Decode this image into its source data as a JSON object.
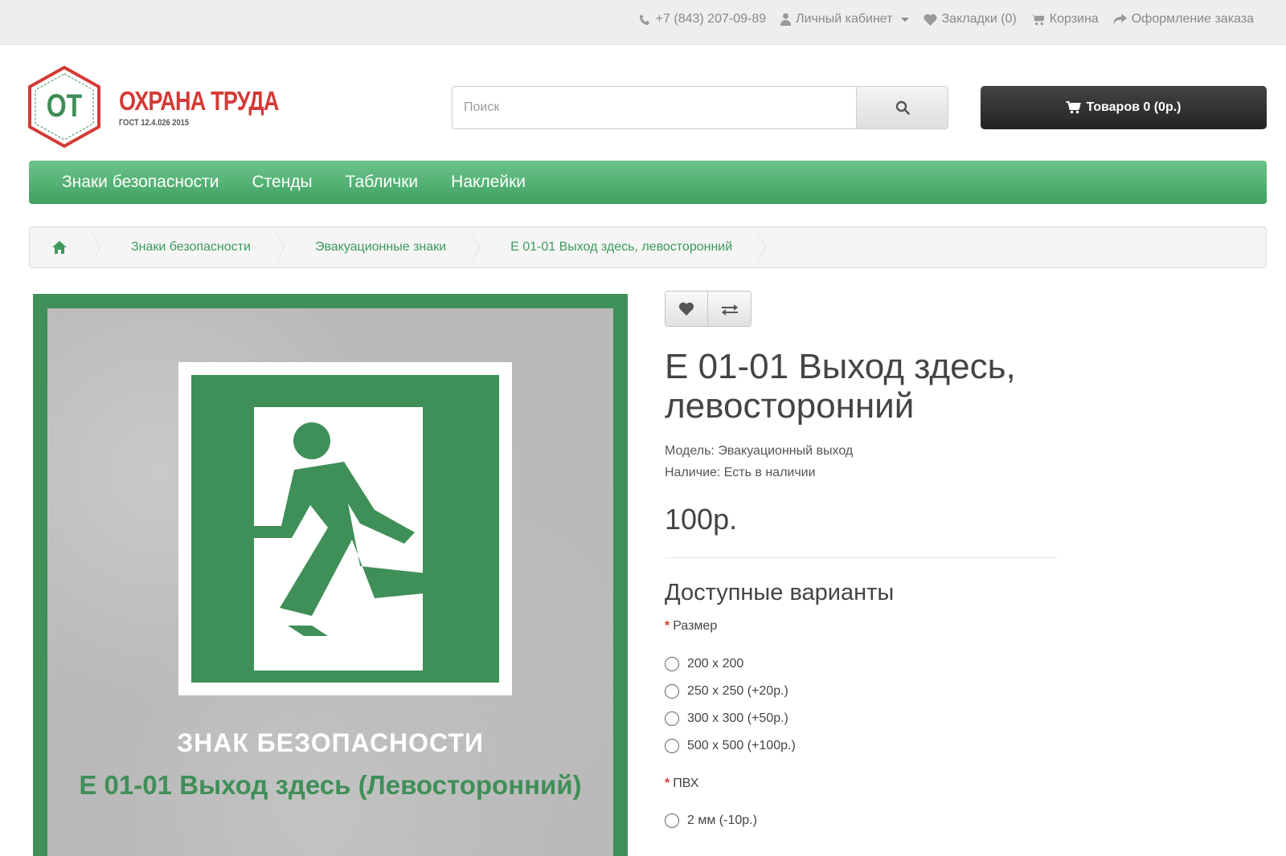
{
  "topbar": {
    "phone": "+7 (843) 207-09-89",
    "account": "Личный кабинет",
    "wishlist": "Закладки (0)",
    "cart": "Корзина",
    "checkout": "Оформление заказа"
  },
  "logo": {
    "mark": "ОТ",
    "name": "ОХРАНА ТРУДА",
    "subtitle": "ГОСТ 12.4.026 2015"
  },
  "search": {
    "placeholder": "Поиск"
  },
  "cart_button": {
    "label": "Товаров 0 (0р.)"
  },
  "menu": {
    "items": [
      "Знаки безопасности",
      "Стенды",
      "Таблички",
      "Наклейки"
    ]
  },
  "breadcrumb": {
    "items": [
      "Знаки безопасности",
      "Эвакуационные знаки",
      "Е 01-01 Выход здесь, левосторонний"
    ]
  },
  "product_image": {
    "caption1": "ЗНАК БЕЗОПАСНОСТИ",
    "caption2": "Е 01-01 Выход здесь (Левосторонний)"
  },
  "product": {
    "title": "Е 01-01 Выход здесь, левосторонний",
    "model": "Модель: Эвакуационный выход",
    "availability": "Наличие: Есть в наличии",
    "price": "100р."
  },
  "options": {
    "title": "Доступные варианты",
    "size_label": "Размер",
    "sizes": [
      "200 х 200",
      "250 х 250 (+20р.)",
      "300 х 300 (+50р.)",
      "500 х 500 (+100р.)"
    ],
    "pvc_label": "ПВХ",
    "pvc": [
      "2 мм (-10р.)"
    ]
  },
  "colors": {
    "brand_green": "#3f8f58",
    "brand_red": "#d33b36",
    "cart_dark": "#2a2a2a"
  }
}
